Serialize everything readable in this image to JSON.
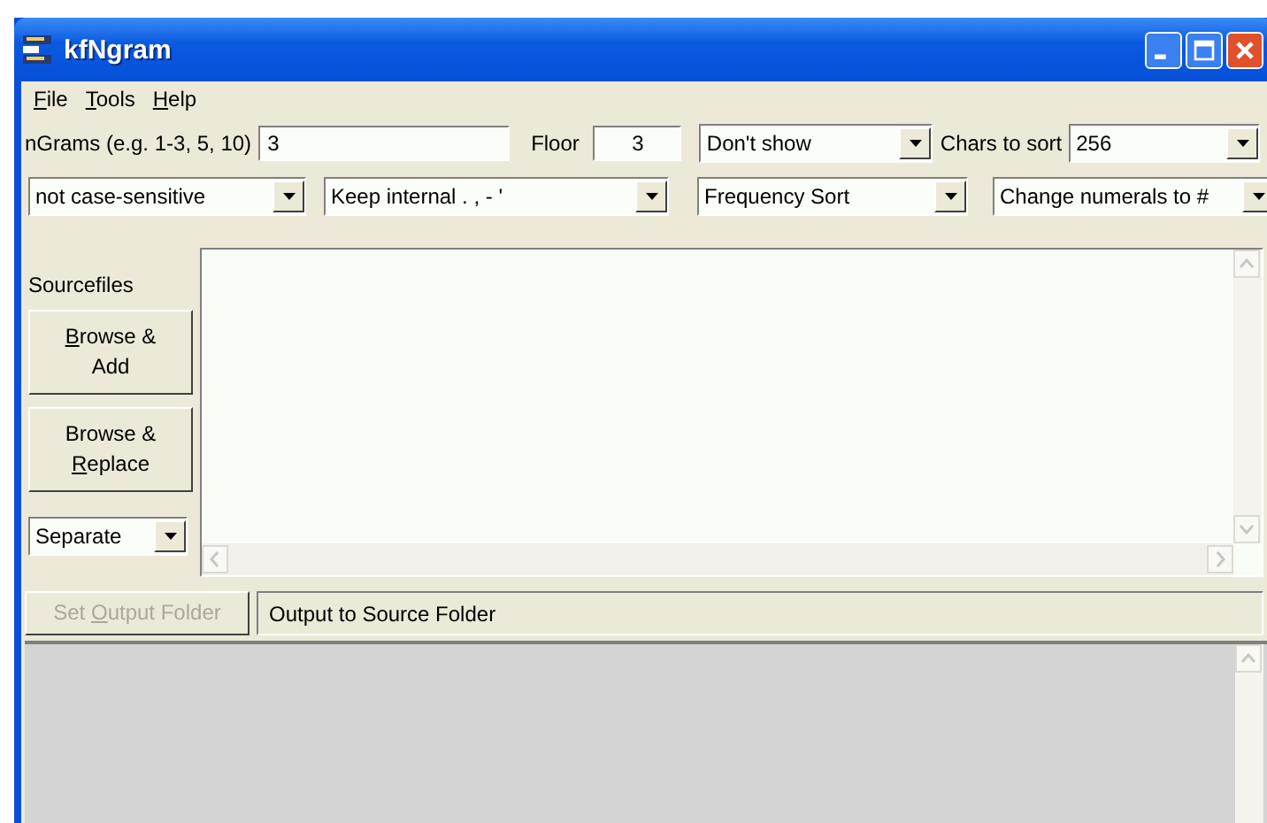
{
  "window": {
    "title": "kfNgram"
  },
  "menu": [
    {
      "underlined": "F",
      "text_after": "ile"
    },
    {
      "underlined": "T",
      "text_after": "ools"
    },
    {
      "underlined": "H",
      "text_after": "elp"
    }
  ],
  "ngrams": {
    "label": "nGrams (e.g. 1-3, 5, 10)",
    "value": "3"
  },
  "floor": {
    "label": "Floor",
    "value": "3"
  },
  "display": {
    "value": "Don't show"
  },
  "chars_to_sort": {
    "label": "Chars to sort",
    "value": "256"
  },
  "options": [
    {
      "value": "not case-sensitive"
    },
    {
      "value": "Keep internal . , - '"
    },
    {
      "value": "Frequency Sort"
    },
    {
      "value": "Change numerals to #"
    }
  ],
  "sourcefiles": {
    "label": "Sourcefiles",
    "buttons": [
      {
        "underlined": "B",
        "text_after": "rowse & Add"
      },
      {
        "text_before": "Browse & ",
        "underlined": "R",
        "text_after": "eplace"
      }
    ],
    "mode": {
      "value": "Separate"
    }
  },
  "output": {
    "button": {
      "text_before": "Set ",
      "underlined": "O",
      "text_after": "utput Folder",
      "disabled": true
    },
    "folder": "Output to Source Folder"
  }
}
